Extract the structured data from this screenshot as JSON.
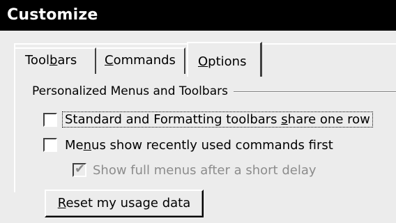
{
  "window": {
    "title": "Customize"
  },
  "tabs": [
    {
      "label": "Toolbars",
      "selected": false
    },
    {
      "label": "Commands",
      "selected": false
    },
    {
      "label": "Options",
      "selected": true
    }
  ],
  "options": {
    "group_label": "Personalized Menus and Toolbars",
    "checkboxes": [
      {
        "label": "Standard and Formatting toolbars share one row",
        "checked": false,
        "enabled": true,
        "focused": true
      },
      {
        "label": "Menus show recently used commands first",
        "checked": false,
        "enabled": true,
        "focused": false
      },
      {
        "label": "Show full menus after a short delay",
        "checked": true,
        "enabled": false,
        "focused": false
      }
    ],
    "reset_button_label": "Reset my usage data"
  },
  "colors": {
    "titlebar_bg": "#000000",
    "titlebar_fg": "#ffffff",
    "dialog_bg": "#ececec",
    "disabled_text": "#8c8c8c"
  }
}
